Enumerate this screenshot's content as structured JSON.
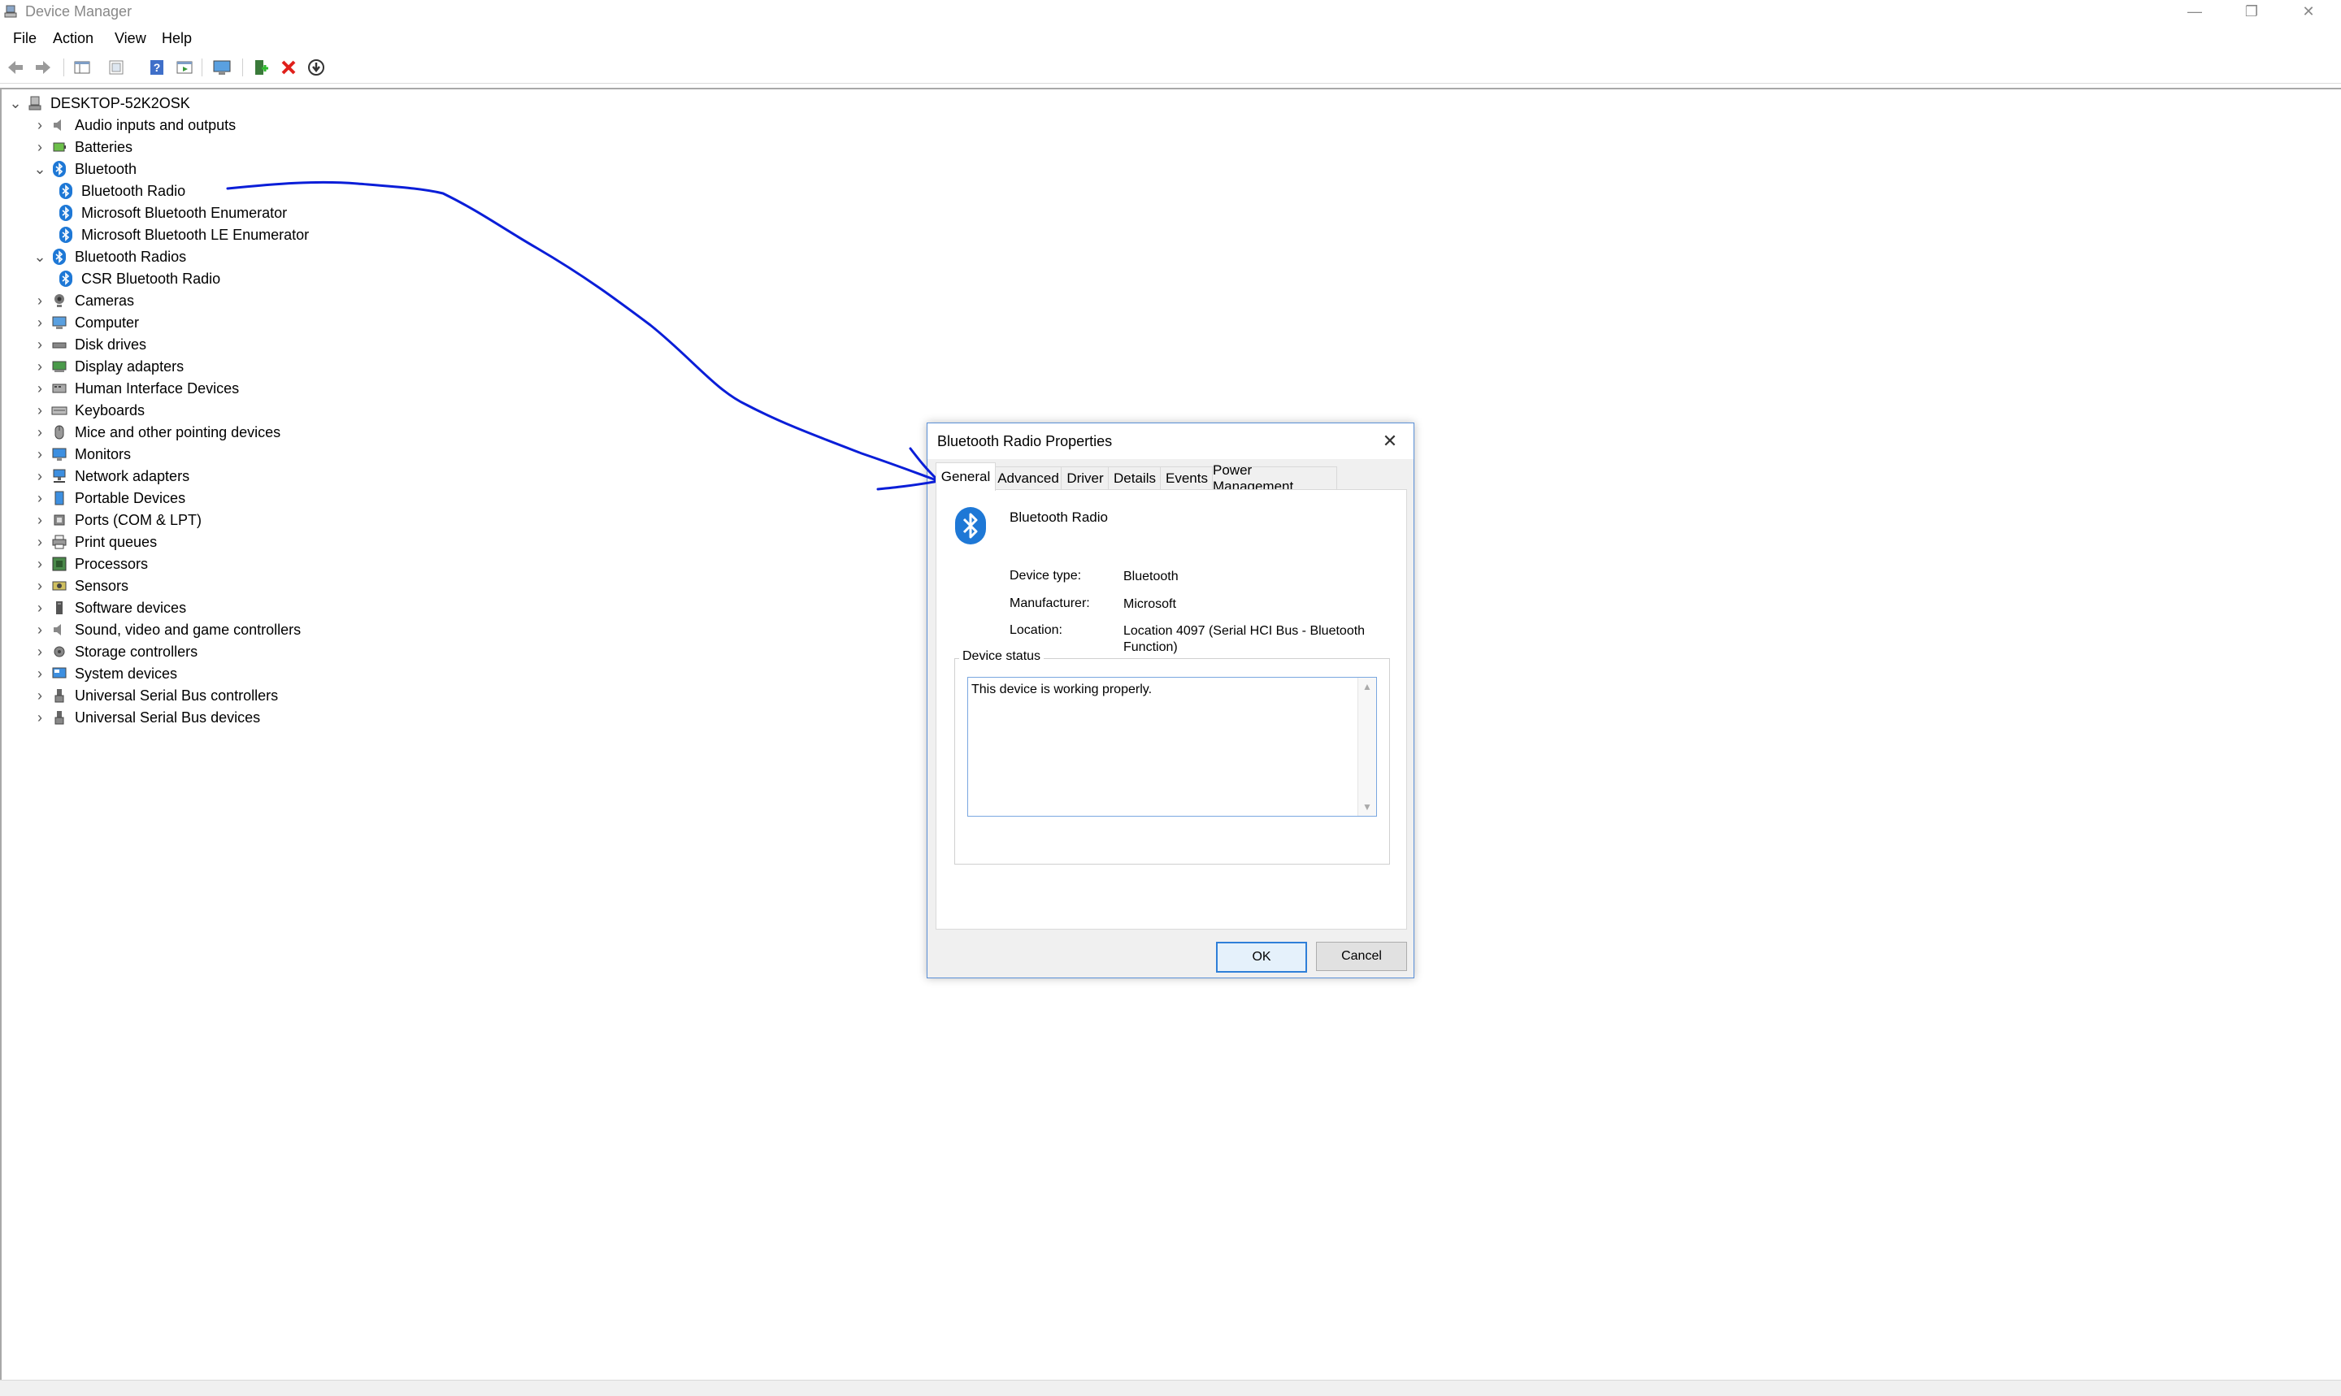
{
  "window": {
    "title": "Device Manager",
    "controls": {
      "minimize": "—",
      "maximize": "❐",
      "close": "✕"
    }
  },
  "menu": [
    "File",
    "Action",
    "View",
    "Help"
  ],
  "toolbar": {
    "icons": [
      "back-arrow-icon",
      "forward-arrow-icon",
      "show-hide-console-tree-icon",
      "properties-icon",
      "help-icon",
      "action-pane-icon",
      "monitor-scan-icon",
      "add-driver-icon",
      "uninstall-icon",
      "update-driver-icon"
    ]
  },
  "tree": {
    "root": "DESKTOP-52K2OSK",
    "items": [
      {
        "label": "Audio inputs and outputs",
        "icon": "speaker-icon",
        "level": 1,
        "chevron": "›"
      },
      {
        "label": "Batteries",
        "icon": "battery-icon",
        "level": 1,
        "chevron": "›"
      },
      {
        "label": "Bluetooth",
        "icon": "bluetooth-icon",
        "level": 1,
        "chevron": "⌄"
      },
      {
        "label": "Bluetooth Radio",
        "icon": "bluetooth-icon",
        "level": 2,
        "chevron": ""
      },
      {
        "label": "Microsoft Bluetooth Enumerator",
        "icon": "bluetooth-icon",
        "level": 2,
        "chevron": ""
      },
      {
        "label": "Microsoft Bluetooth LE Enumerator",
        "icon": "bluetooth-icon",
        "level": 2,
        "chevron": ""
      },
      {
        "label": "Bluetooth Radios",
        "icon": "bluetooth-icon",
        "level": 1,
        "chevron": "⌄"
      },
      {
        "label": "CSR Bluetooth Radio",
        "icon": "bluetooth-icon",
        "level": 2,
        "chevron": ""
      },
      {
        "label": "Cameras",
        "icon": "camera-icon",
        "level": 1,
        "chevron": "›"
      },
      {
        "label": "Computer",
        "icon": "computer-icon",
        "level": 1,
        "chevron": "›"
      },
      {
        "label": "Disk drives",
        "icon": "disk-drive-icon",
        "level": 1,
        "chevron": "›"
      },
      {
        "label": "Display adapters",
        "icon": "display-adapter-icon",
        "level": 1,
        "chevron": "›"
      },
      {
        "label": "Human Interface Devices",
        "icon": "hid-icon",
        "level": 1,
        "chevron": "›"
      },
      {
        "label": "Keyboards",
        "icon": "keyboard-icon",
        "level": 1,
        "chevron": "›"
      },
      {
        "label": "Mice and other pointing devices",
        "icon": "mouse-icon",
        "level": 1,
        "chevron": "›"
      },
      {
        "label": "Monitors",
        "icon": "monitor-icon",
        "level": 1,
        "chevron": "›"
      },
      {
        "label": "Network adapters",
        "icon": "network-icon",
        "level": 1,
        "chevron": "›"
      },
      {
        "label": "Portable Devices",
        "icon": "portable-device-icon",
        "level": 1,
        "chevron": "›"
      },
      {
        "label": "Ports (COM & LPT)",
        "icon": "port-icon",
        "level": 1,
        "chevron": "›"
      },
      {
        "label": "Print queues",
        "icon": "printer-icon",
        "level": 1,
        "chevron": "›"
      },
      {
        "label": "Processors",
        "icon": "processor-icon",
        "level": 1,
        "chevron": "›"
      },
      {
        "label": "Sensors",
        "icon": "sensor-icon",
        "level": 1,
        "chevron": "›"
      },
      {
        "label": "Software devices",
        "icon": "software-device-icon",
        "level": 1,
        "chevron": "›"
      },
      {
        "label": "Sound, video and game controllers",
        "icon": "speaker-icon",
        "level": 1,
        "chevron": "›"
      },
      {
        "label": "Storage controllers",
        "icon": "storage-controller-icon",
        "level": 1,
        "chevron": "›"
      },
      {
        "label": "System devices",
        "icon": "system-device-icon",
        "level": 1,
        "chevron": "›"
      },
      {
        "label": "Universal Serial Bus controllers",
        "icon": "usb-icon",
        "level": 1,
        "chevron": "›"
      },
      {
        "label": "Universal Serial Bus devices",
        "icon": "usb-icon",
        "level": 1,
        "chevron": "›"
      }
    ]
  },
  "dialog": {
    "title": "Bluetooth Radio Properties",
    "close": "✕",
    "tabs": [
      "General",
      "Advanced",
      "Driver",
      "Details",
      "Events",
      "Power Management"
    ],
    "active_tab": "General",
    "device_name": "Bluetooth Radio",
    "properties": [
      {
        "label": "Device type:",
        "value": "Bluetooth"
      },
      {
        "label": "Manufacturer:",
        "value": "Microsoft"
      },
      {
        "label": "Location:",
        "value": "Location 4097 (Serial HCI Bus - Bluetooth Function)"
      }
    ],
    "status_group": "Device status",
    "status_text": "This device is working properly.",
    "scroll_up": "▲",
    "scroll_down": "▼",
    "ok": "OK",
    "cancel": "Cancel"
  },
  "colors": {
    "bluetooth": "#1e78d6",
    "annotation": "#0a1ed8",
    "dialog_border": "#5a8fd6",
    "toolbar_red_x": "#e0201b"
  }
}
